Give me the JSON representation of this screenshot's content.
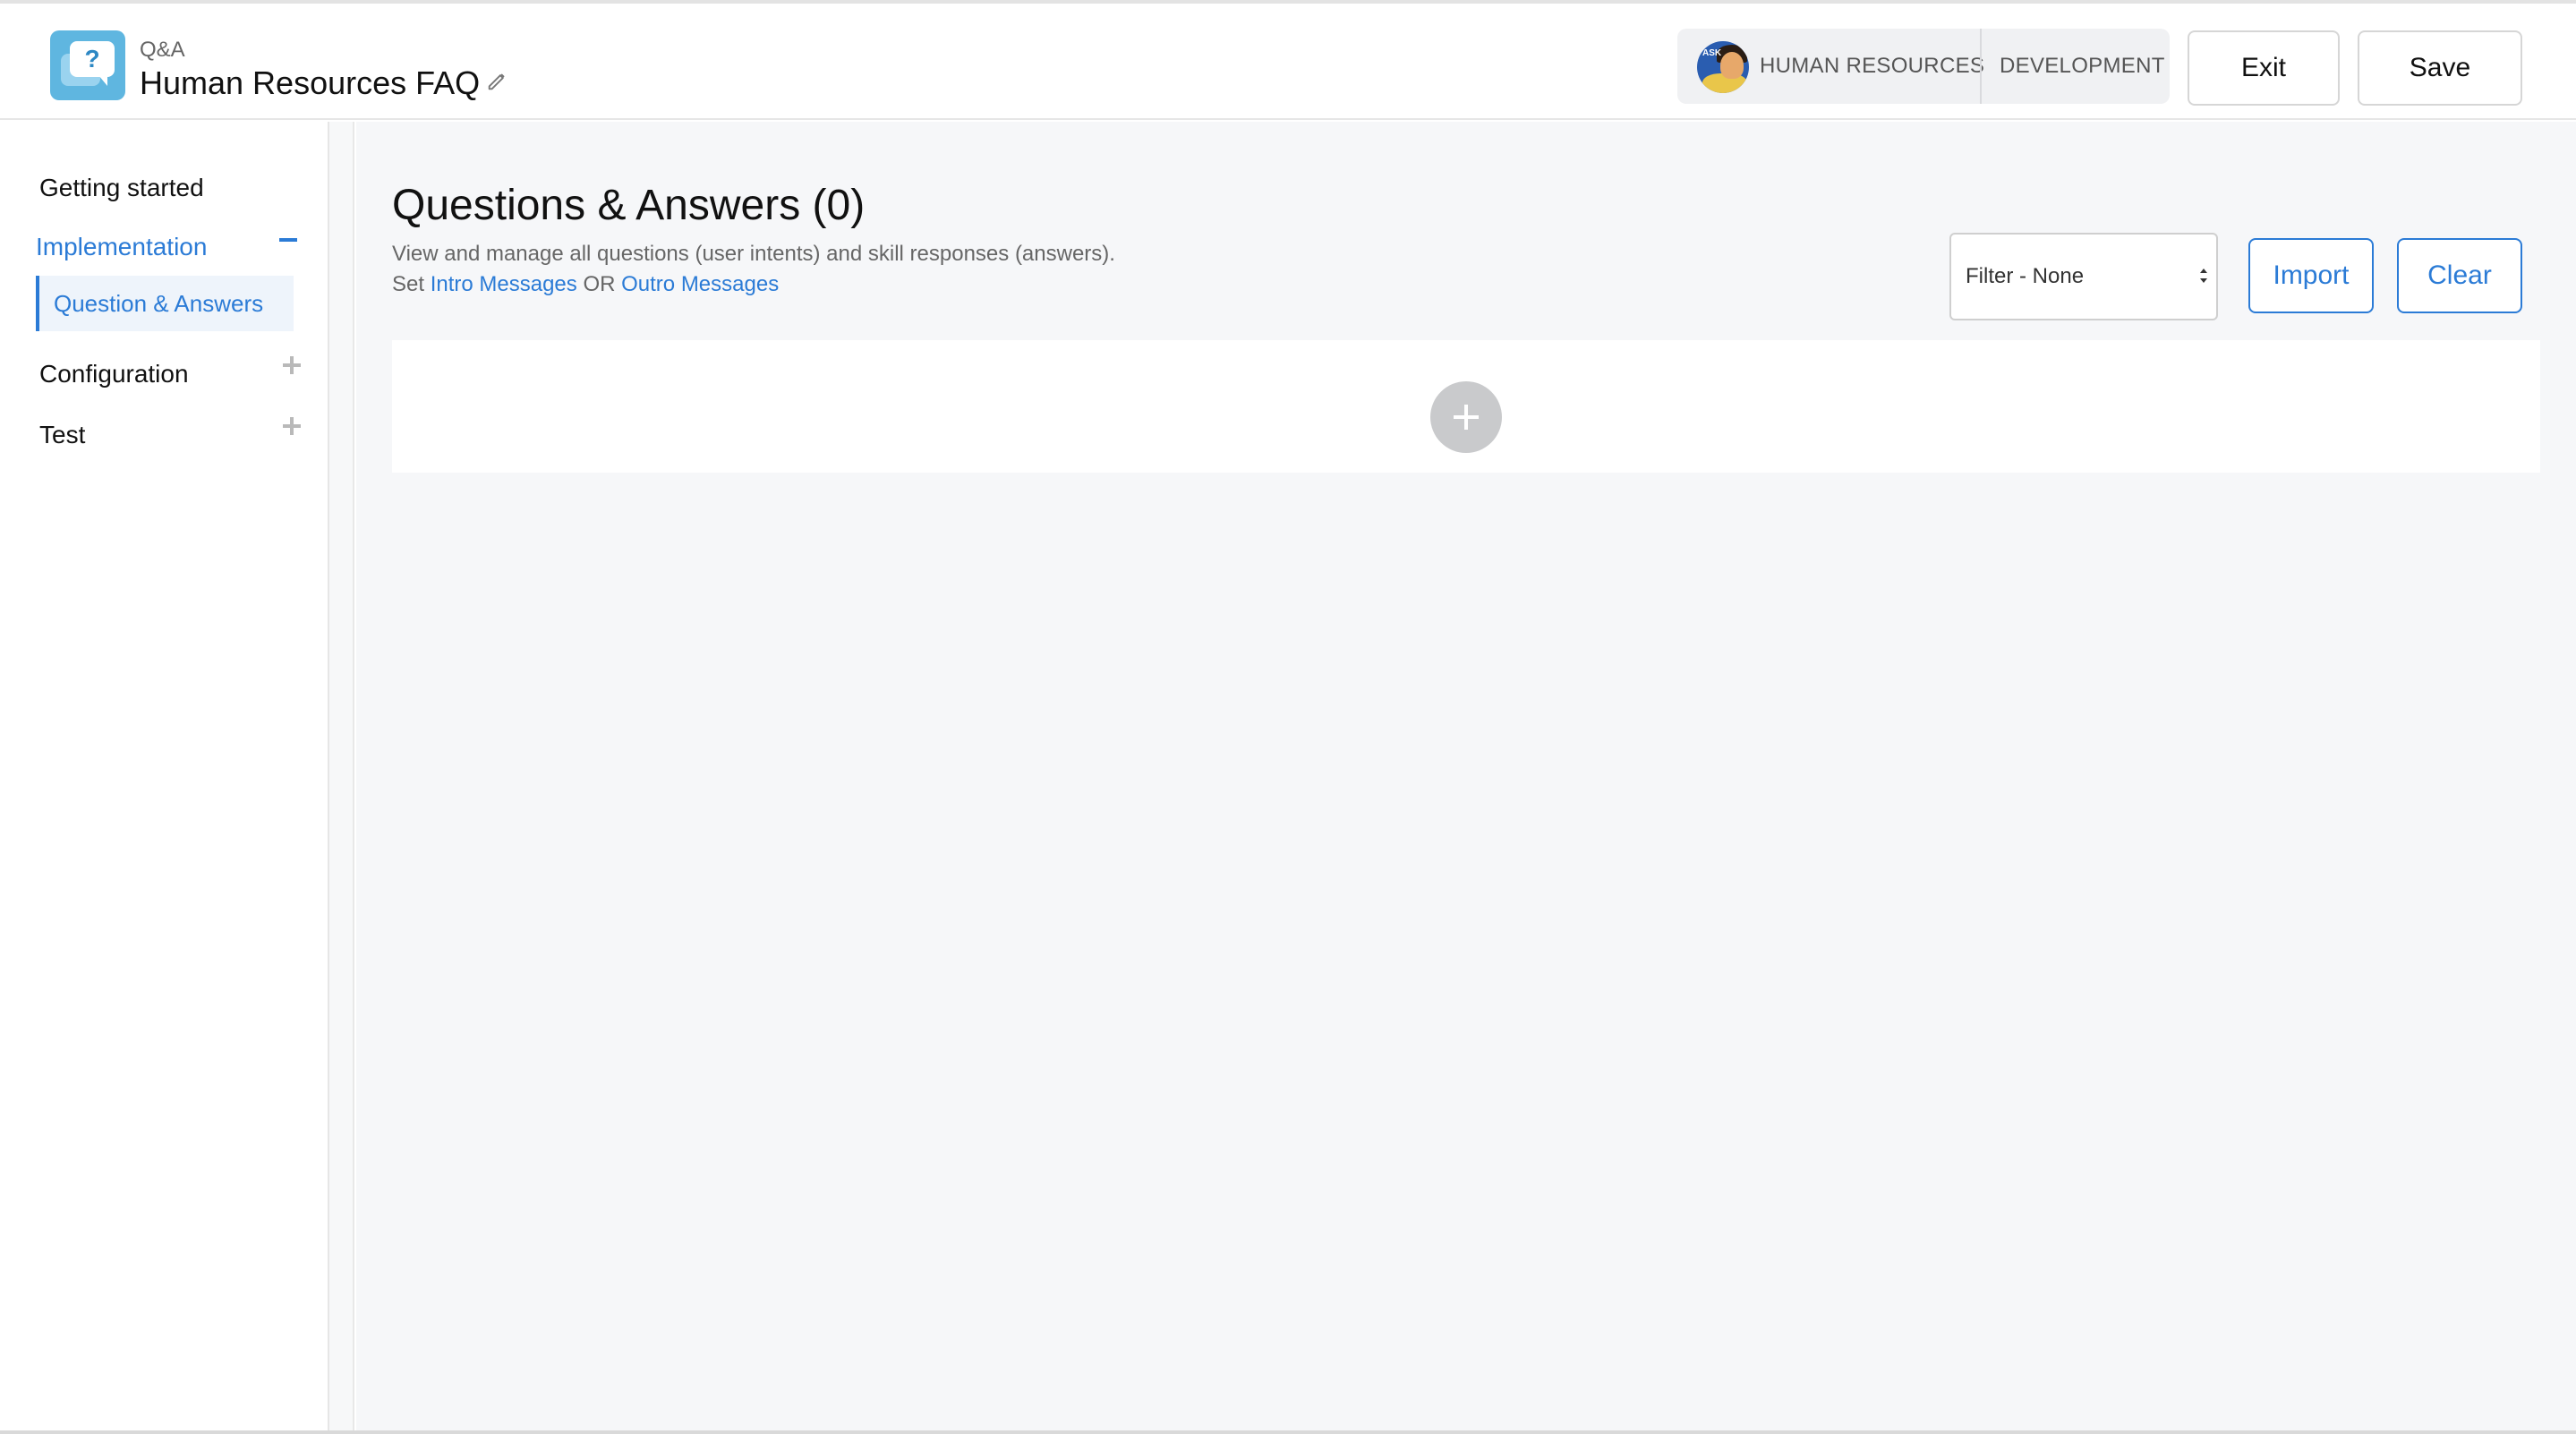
{
  "header": {
    "app_type": "Q&A",
    "app_title": "Human Resources FAQ",
    "environment": {
      "primary_label": "HUMAN RESOURCES",
      "secondary_label": "DEVELOPMENT",
      "avatar_text": "ASK"
    },
    "exit_label": "Exit",
    "save_label": "Save"
  },
  "sidebar": {
    "items": [
      {
        "label": "Getting started"
      },
      {
        "label": "Implementation",
        "expanded": true,
        "children": [
          {
            "label": "Question & Answers",
            "active": true
          }
        ]
      },
      {
        "label": "Configuration",
        "expanded": false
      },
      {
        "label": "Test",
        "expanded": false
      }
    ]
  },
  "main": {
    "title": "Questions & Answers (0)",
    "description": "View and manage all questions (user intents) and skill responses (answers).",
    "set_prefix": "Set",
    "intro_link": "Intro Messages",
    "or_text": "OR",
    "outro_link": "Outro Messages",
    "filter": {
      "selected": "Filter - None"
    },
    "import_label": "Import",
    "clear_label": "Clear"
  },
  "colors": {
    "accent": "#2b7bd6",
    "logo": "#5fb6e0",
    "background": "#f6f7f9"
  },
  "icons": [
    "qa-logo-icon",
    "pencil-icon",
    "minus-icon",
    "plus-icon",
    "select-arrows-icon",
    "add-circle-icon"
  ]
}
